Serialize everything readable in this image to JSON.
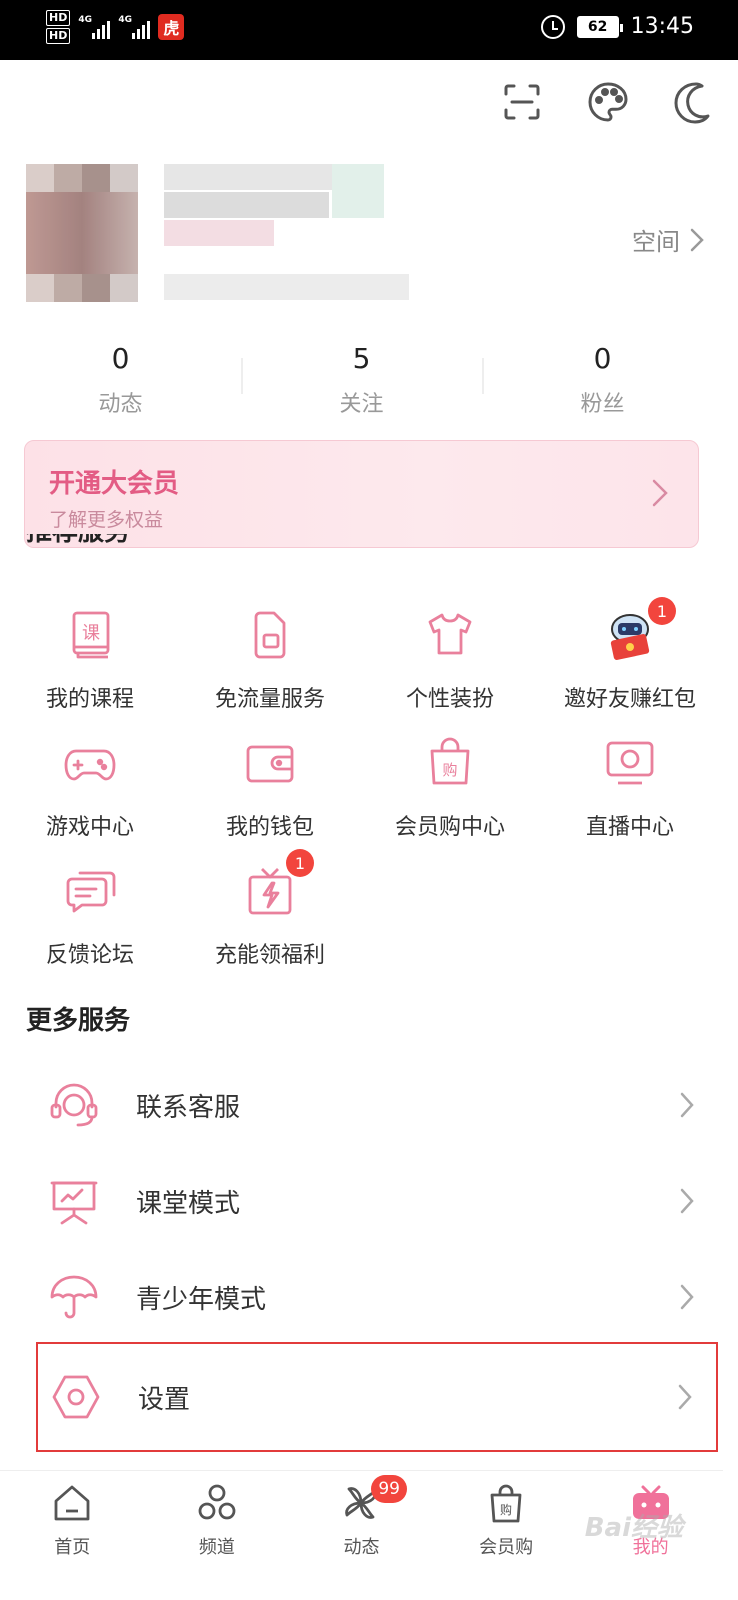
{
  "status_bar": {
    "hd1": "HD",
    "hd2": "HD",
    "net1": "4G",
    "net2": "4G",
    "battery": "62",
    "time": "13:45"
  },
  "profile": {
    "space_label": "空间"
  },
  "stats": [
    {
      "value": "0",
      "label": "动态"
    },
    {
      "value": "5",
      "label": "关注"
    },
    {
      "value": "0",
      "label": "粉丝"
    }
  ],
  "vip": {
    "title": "开通大会员",
    "subtitle": "了解更多权益"
  },
  "recommended": {
    "title": "推荐服务",
    "items": [
      {
        "label": "我的课程",
        "icon": "course-book-icon"
      },
      {
        "label": "免流量服务",
        "icon": "sim-card-icon"
      },
      {
        "label": "个性装扮",
        "icon": "tshirt-icon"
      },
      {
        "label": "邀好友赚红包",
        "icon": "mascot-red-packet-icon",
        "badge": "1"
      },
      {
        "label": "游戏中心",
        "icon": "gamepad-icon"
      },
      {
        "label": "我的钱包",
        "icon": "wallet-icon"
      },
      {
        "label": "会员购中心",
        "icon": "shopping-bag-icon"
      },
      {
        "label": "直播中心",
        "icon": "tv-live-icon"
      },
      {
        "label": "反馈论坛",
        "icon": "chat-bubbles-icon"
      },
      {
        "label": "充能领福利",
        "icon": "gift-lightning-icon",
        "badge": "1"
      }
    ]
  },
  "more": {
    "title": "更多服务",
    "items": [
      {
        "label": "联系客服",
        "icon": "headset-icon"
      },
      {
        "label": "课堂模式",
        "icon": "classroom-board-icon"
      },
      {
        "label": "青少年模式",
        "icon": "umbrella-icon"
      },
      {
        "label": "设置",
        "icon": "settings-hexagon-icon"
      }
    ]
  },
  "bottom_nav": [
    {
      "label": "首页",
      "icon": "home-icon"
    },
    {
      "label": "频道",
      "icon": "channels-icon"
    },
    {
      "label": "动态",
      "icon": "pinwheel-icon",
      "badge": "99"
    },
    {
      "label": "会员购",
      "icon": "shopping-bag-icon"
    },
    {
      "label": "我的",
      "icon": "tv-mascot-icon",
      "active": true
    }
  ],
  "colors": {
    "accent": "#f0719a",
    "icon_pink": "#e9809c",
    "badge_red": "#f2453d",
    "highlight_border": "#e23b3b"
  }
}
